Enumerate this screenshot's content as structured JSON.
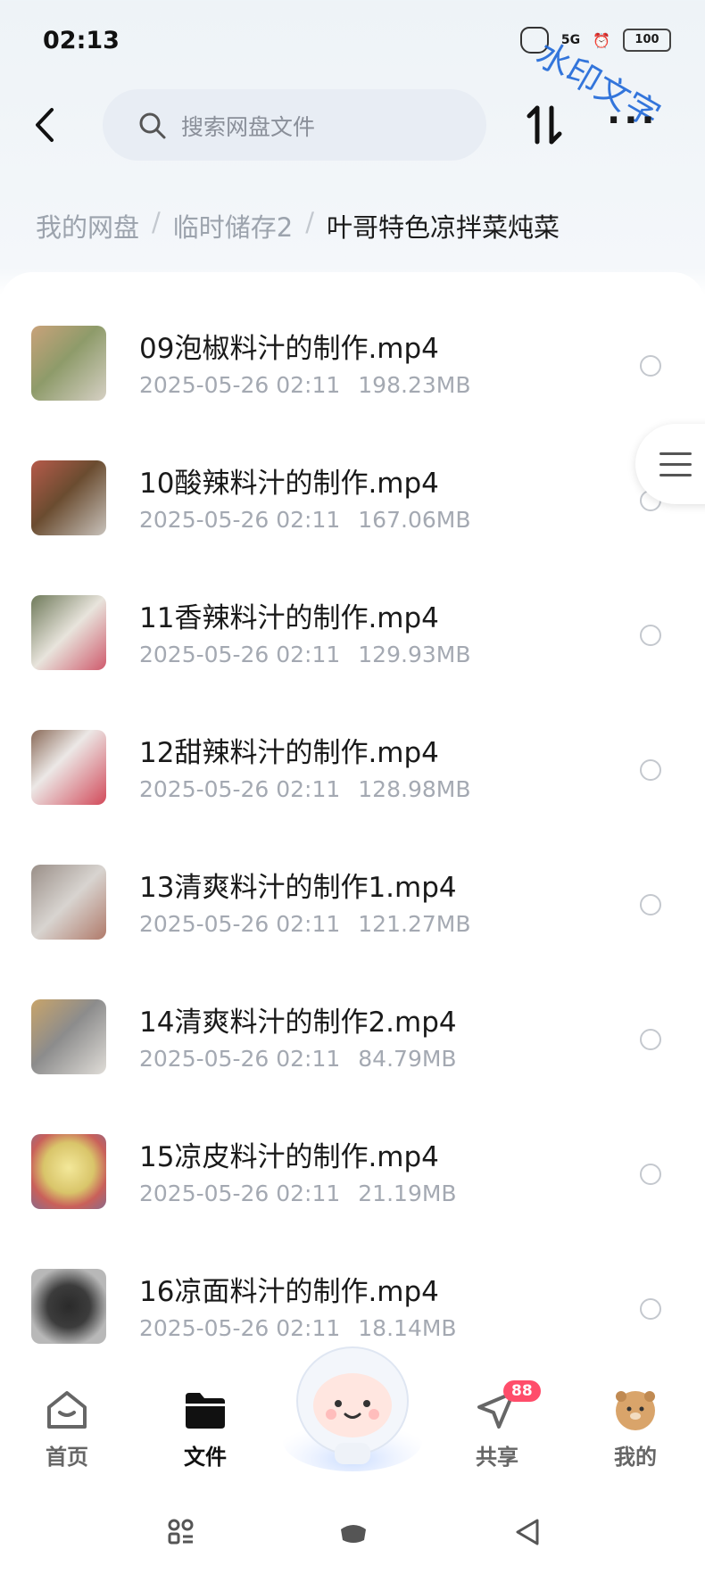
{
  "status": {
    "time": "02:13",
    "network": "5G",
    "battery": "100",
    "watermark": "水印文字"
  },
  "search": {
    "placeholder": "搜索网盘文件"
  },
  "breadcrumb": {
    "items": [
      "我的网盘",
      "临时储存2",
      "叶哥特色凉拌菜炖菜"
    ]
  },
  "files": [
    {
      "name": "09泡椒料汁的制作.mp4",
      "date": "2025-05-26  02:11",
      "size": "198.23MB"
    },
    {
      "name": "10酸辣料汁的制作.mp4",
      "date": "2025-05-26  02:11",
      "size": "167.06MB"
    },
    {
      "name": "11香辣料汁的制作.mp4",
      "date": "2025-05-26  02:11",
      "size": "129.93MB"
    },
    {
      "name": "12甜辣料汁的制作.mp4",
      "date": "2025-05-26  02:11",
      "size": "128.98MB"
    },
    {
      "name": "13清爽料汁的制作1.mp4",
      "date": "2025-05-26  02:11",
      "size": "121.27MB"
    },
    {
      "name": "14清爽料汁的制作2.mp4",
      "date": "2025-05-26  02:11",
      "size": "84.79MB"
    },
    {
      "name": "15凉皮料汁的制作.mp4",
      "date": "2025-05-26  02:11",
      "size": "21.19MB"
    },
    {
      "name": "16凉面料汁的制作.mp4",
      "date": "2025-05-26  02:11",
      "size": "18.14MB"
    }
  ],
  "tabs": {
    "home": "首页",
    "files": "文件",
    "share": "共享",
    "mine": "我的",
    "share_badge": "88"
  },
  "colors": {
    "accent": "#1a1a1a",
    "badge": "#ff4d6a",
    "watermark": "#1f68d8"
  }
}
